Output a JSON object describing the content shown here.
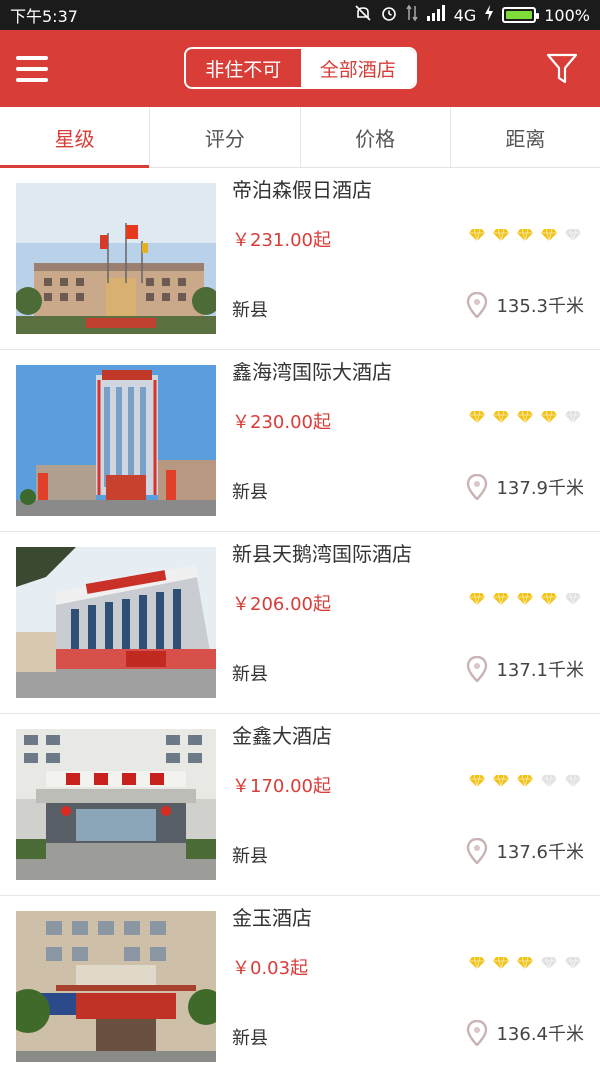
{
  "status_bar": {
    "time": "下午5:37",
    "network": "4G",
    "battery_percent": "100%",
    "battery_level": 1.0,
    "icons": [
      "mute-icon",
      "alarm-icon",
      "data-arrows-icon",
      "signal-icon",
      "charging-icon",
      "battery-icon"
    ]
  },
  "header": {
    "menu_icon": "menu-icon",
    "segments": [
      {
        "label": "非住不可",
        "active": false
      },
      {
        "label": "全部酒店",
        "active": true
      }
    ],
    "filter_icon": "filter-icon"
  },
  "tabs": [
    {
      "label": "星级",
      "selected": true
    },
    {
      "label": "评分",
      "selected": false
    },
    {
      "label": "价格",
      "selected": false
    },
    {
      "label": "距离",
      "selected": false
    }
  ],
  "colors": {
    "brand_red": "#d83d38",
    "star_gold": "#f2c316",
    "star_empty": "#e0e0e0"
  },
  "hotels": [
    {
      "name": "帝泊森假日酒店",
      "price": "￥231.00起",
      "stars": 4,
      "area": "新县",
      "distance": "135.3千米"
    },
    {
      "name": "鑫海湾国际大酒店",
      "price": "￥230.00起",
      "stars": 4,
      "area": "新县",
      "distance": "137.9千米"
    },
    {
      "name": "新县天鹅湾国际酒店",
      "price": "￥206.00起",
      "stars": 4,
      "area": "新县",
      "distance": "137.1千米"
    },
    {
      "name": "金鑫大酒店",
      "price": "￥170.00起",
      "stars": 3,
      "area": "新县",
      "distance": "137.6千米"
    },
    {
      "name": "金玉酒店",
      "price": "￥0.03起",
      "stars": 3,
      "area": "新县",
      "distance": "136.4千米"
    }
  ]
}
